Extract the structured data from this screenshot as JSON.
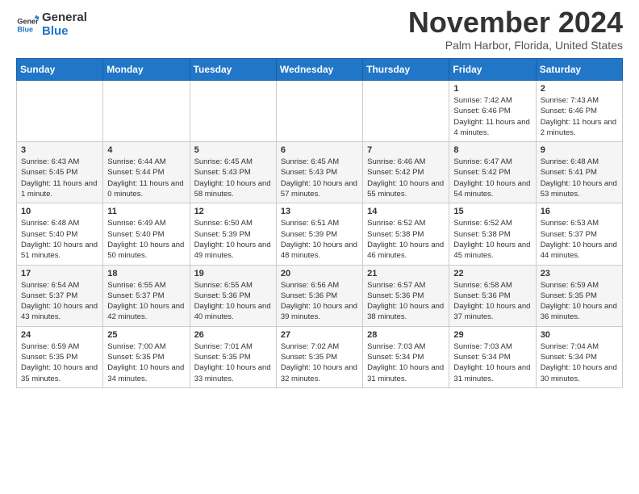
{
  "header": {
    "logo_line1": "General",
    "logo_line2": "Blue",
    "month": "November 2024",
    "location": "Palm Harbor, Florida, United States"
  },
  "weekdays": [
    "Sunday",
    "Monday",
    "Tuesday",
    "Wednesday",
    "Thursday",
    "Friday",
    "Saturday"
  ],
  "weeks": [
    [
      {
        "day": "",
        "info": ""
      },
      {
        "day": "",
        "info": ""
      },
      {
        "day": "",
        "info": ""
      },
      {
        "day": "",
        "info": ""
      },
      {
        "day": "",
        "info": ""
      },
      {
        "day": "1",
        "info": "Sunrise: 7:42 AM\nSunset: 6:46 PM\nDaylight: 11 hours and 4 minutes."
      },
      {
        "day": "2",
        "info": "Sunrise: 7:43 AM\nSunset: 6:46 PM\nDaylight: 11 hours and 2 minutes."
      }
    ],
    [
      {
        "day": "3",
        "info": "Sunrise: 6:43 AM\nSunset: 5:45 PM\nDaylight: 11 hours and 1 minute."
      },
      {
        "day": "4",
        "info": "Sunrise: 6:44 AM\nSunset: 5:44 PM\nDaylight: 11 hours and 0 minutes."
      },
      {
        "day": "5",
        "info": "Sunrise: 6:45 AM\nSunset: 5:43 PM\nDaylight: 10 hours and 58 minutes."
      },
      {
        "day": "6",
        "info": "Sunrise: 6:45 AM\nSunset: 5:43 PM\nDaylight: 10 hours and 57 minutes."
      },
      {
        "day": "7",
        "info": "Sunrise: 6:46 AM\nSunset: 5:42 PM\nDaylight: 10 hours and 55 minutes."
      },
      {
        "day": "8",
        "info": "Sunrise: 6:47 AM\nSunset: 5:42 PM\nDaylight: 10 hours and 54 minutes."
      },
      {
        "day": "9",
        "info": "Sunrise: 6:48 AM\nSunset: 5:41 PM\nDaylight: 10 hours and 53 minutes."
      }
    ],
    [
      {
        "day": "10",
        "info": "Sunrise: 6:48 AM\nSunset: 5:40 PM\nDaylight: 10 hours and 51 minutes."
      },
      {
        "day": "11",
        "info": "Sunrise: 6:49 AM\nSunset: 5:40 PM\nDaylight: 10 hours and 50 minutes."
      },
      {
        "day": "12",
        "info": "Sunrise: 6:50 AM\nSunset: 5:39 PM\nDaylight: 10 hours and 49 minutes."
      },
      {
        "day": "13",
        "info": "Sunrise: 6:51 AM\nSunset: 5:39 PM\nDaylight: 10 hours and 48 minutes."
      },
      {
        "day": "14",
        "info": "Sunrise: 6:52 AM\nSunset: 5:38 PM\nDaylight: 10 hours and 46 minutes."
      },
      {
        "day": "15",
        "info": "Sunrise: 6:52 AM\nSunset: 5:38 PM\nDaylight: 10 hours and 45 minutes."
      },
      {
        "day": "16",
        "info": "Sunrise: 6:53 AM\nSunset: 5:37 PM\nDaylight: 10 hours and 44 minutes."
      }
    ],
    [
      {
        "day": "17",
        "info": "Sunrise: 6:54 AM\nSunset: 5:37 PM\nDaylight: 10 hours and 43 minutes."
      },
      {
        "day": "18",
        "info": "Sunrise: 6:55 AM\nSunset: 5:37 PM\nDaylight: 10 hours and 42 minutes."
      },
      {
        "day": "19",
        "info": "Sunrise: 6:55 AM\nSunset: 5:36 PM\nDaylight: 10 hours and 40 minutes."
      },
      {
        "day": "20",
        "info": "Sunrise: 6:56 AM\nSunset: 5:36 PM\nDaylight: 10 hours and 39 minutes."
      },
      {
        "day": "21",
        "info": "Sunrise: 6:57 AM\nSunset: 5:36 PM\nDaylight: 10 hours and 38 minutes."
      },
      {
        "day": "22",
        "info": "Sunrise: 6:58 AM\nSunset: 5:36 PM\nDaylight: 10 hours and 37 minutes."
      },
      {
        "day": "23",
        "info": "Sunrise: 6:59 AM\nSunset: 5:35 PM\nDaylight: 10 hours and 36 minutes."
      }
    ],
    [
      {
        "day": "24",
        "info": "Sunrise: 6:59 AM\nSunset: 5:35 PM\nDaylight: 10 hours and 35 minutes."
      },
      {
        "day": "25",
        "info": "Sunrise: 7:00 AM\nSunset: 5:35 PM\nDaylight: 10 hours and 34 minutes."
      },
      {
        "day": "26",
        "info": "Sunrise: 7:01 AM\nSunset: 5:35 PM\nDaylight: 10 hours and 33 minutes."
      },
      {
        "day": "27",
        "info": "Sunrise: 7:02 AM\nSunset: 5:35 PM\nDaylight: 10 hours and 32 minutes."
      },
      {
        "day": "28",
        "info": "Sunrise: 7:03 AM\nSunset: 5:34 PM\nDaylight: 10 hours and 31 minutes."
      },
      {
        "day": "29",
        "info": "Sunrise: 7:03 AM\nSunset: 5:34 PM\nDaylight: 10 hours and 31 minutes."
      },
      {
        "day": "30",
        "info": "Sunrise: 7:04 AM\nSunset: 5:34 PM\nDaylight: 10 hours and 30 minutes."
      }
    ]
  ]
}
